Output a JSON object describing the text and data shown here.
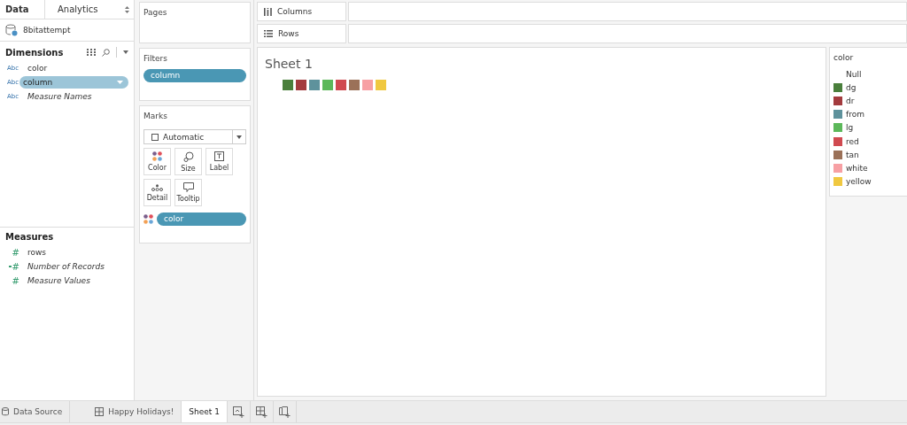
{
  "side_tabs": [
    {
      "label": "Data",
      "selected": true
    },
    {
      "label": "Analytics",
      "selected": false
    }
  ],
  "datasource": "8bitattempt",
  "dimensions": {
    "title": "Dimensions",
    "items": [
      {
        "icon_text": "Abc",
        "name": "color",
        "italic": false,
        "selected": false
      },
      {
        "icon_text": "Abc",
        "name": "column",
        "italic": false,
        "selected": true
      },
      {
        "icon_text": "Abc",
        "name": "Measure Names",
        "italic": true,
        "selected": false
      }
    ]
  },
  "measures": {
    "title": "Measures",
    "items": [
      {
        "icon_text": "#",
        "name": "rows",
        "italic": false,
        "generated": false
      },
      {
        "icon_text": "#",
        "name": "Number of Records",
        "italic": true,
        "generated": true
      },
      {
        "icon_text": "#",
        "name": "Measure Values",
        "italic": true,
        "generated": false
      }
    ]
  },
  "pages": {
    "title": "Pages"
  },
  "filters": {
    "title": "Filters",
    "pills": [
      "column"
    ]
  },
  "marks": {
    "title": "Marks",
    "type": "Automatic",
    "cards": [
      {
        "kind": "color",
        "label": "Color"
      },
      {
        "kind": "size",
        "label": "Size"
      },
      {
        "kind": "label",
        "label": "Label"
      },
      {
        "kind": "detail",
        "label": "Detail"
      },
      {
        "kind": "tooltip",
        "label": "Tooltip"
      }
    ],
    "pills": [
      {
        "kind": "color",
        "label": "color"
      }
    ]
  },
  "shelves": [
    {
      "kind": "columns",
      "label": "Columns"
    },
    {
      "kind": "rows",
      "label": "Rows"
    }
  ],
  "sheet": {
    "title": "Sheet 1",
    "marks": [
      {
        "color": "#4a7f3c"
      },
      {
        "color": "#a33b3e"
      },
      {
        "color": "#5e929c"
      },
      {
        "color": "#5cb85a"
      },
      {
        "color": "#d04a50"
      },
      {
        "color": "#9b7158"
      },
      {
        "color": "#f7a0a4"
      },
      {
        "color": "#f0c840"
      }
    ]
  },
  "legend": {
    "title": "color",
    "items": [
      {
        "label": "Null"
      },
      {
        "label": "dg",
        "color": "#4a7f3c"
      },
      {
        "label": "dr",
        "color": "#a33b3e"
      },
      {
        "label": "from",
        "color": "#5e929c"
      },
      {
        "label": "lg",
        "color": "#5cb85a"
      },
      {
        "label": "red",
        "color": "#d04a50"
      },
      {
        "label": "tan",
        "color": "#9b7158"
      },
      {
        "label": "white",
        "color": "#f7a0a4"
      },
      {
        "label": "yellow",
        "color": "#f0c840"
      }
    ]
  },
  "sheet_tabs": [
    {
      "kind": "datasource",
      "label": "Data Source",
      "selected": false
    },
    {
      "kind": "dashboard",
      "label": "Happy Holidays!",
      "selected": false
    },
    {
      "kind": "sheet",
      "label": "Sheet 1",
      "selected": true
    }
  ],
  "new_buttons": [
    {
      "kind": "worksheet"
    },
    {
      "kind": "dashboard"
    },
    {
      "kind": "story"
    }
  ]
}
